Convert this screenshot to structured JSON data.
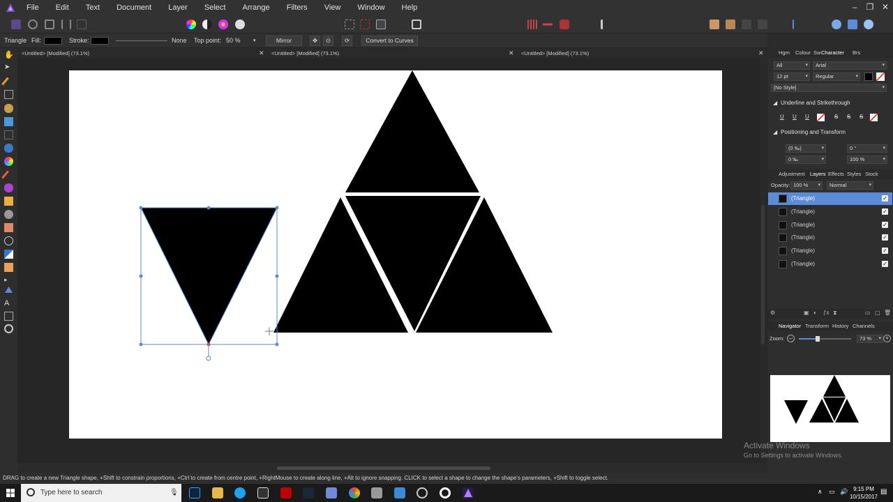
{
  "menubar": {
    "items": [
      "File",
      "Edit",
      "Text",
      "Document",
      "Layer",
      "Select",
      "Arrange",
      "Filters",
      "View",
      "Window",
      "Help"
    ]
  },
  "context": {
    "tool_name": "Triangle",
    "fill_label": "Fill:",
    "stroke_label": "Stroke:",
    "stroke_value": "None",
    "top_point_label": "Top point:",
    "top_point_value": "50 %",
    "mirror_label": "Mirror",
    "convert_label": "Convert to Curves"
  },
  "tabs": [
    {
      "label": "<Untitled> [Modified] (73.1%)"
    },
    {
      "label": "<Untitled> [Modified] (73.1%)"
    },
    {
      "label": "<Untitled> [Modified] (73.1%)"
    }
  ],
  "panel_top": {
    "tabs": [
      "Hgm",
      "Colour",
      "Sw",
      "Character",
      "Brs"
    ],
    "font_collection": "All",
    "font_family": "Arial",
    "font_size": "12 pt",
    "font_style": "Regular",
    "text_style": "[No Style]",
    "section_underline": "Underline and Strikethrough",
    "section_position": "Positioning and Transform",
    "tracking": "(0 ‰)",
    "baseline": "0 ‰",
    "skew": "0 °",
    "scale": "100 %"
  },
  "panel_layers": {
    "tabs": [
      "Adjustment",
      "Layers",
      "Effects",
      "Styles",
      "Stock"
    ],
    "opacity_label": "Opacity:",
    "opacity_value": "100 %",
    "blend_mode": "Normal",
    "layers": [
      {
        "name": "(Triangle)",
        "selected": true
      },
      {
        "name": "(Triangle)",
        "selected": false
      },
      {
        "name": "(Triangle)",
        "selected": false
      },
      {
        "name": "(Triangle)",
        "selected": false
      },
      {
        "name": "(Triangle)",
        "selected": false
      },
      {
        "name": "(Triangle)",
        "selected": false
      }
    ]
  },
  "panel_nav": {
    "tabs": [
      "Navigator",
      "Transform",
      "History",
      "Channels"
    ],
    "zoom_label": "Zoom:",
    "zoom_value": "73 %"
  },
  "status": {
    "hint": "DRAG to create a new Triangle shape, +Shift to constrain proportions, +Ctrl to create from centre point, +RightMouse to create along line, +Alt to ignore snapping. CLICK to select a shape to change the shape's parameters, +Shift to toggle select."
  },
  "watermark": {
    "line1": "Activate Windows",
    "line2": "Go to Settings to activate Windows."
  },
  "taskbar": {
    "search_placeholder": "Type here to search",
    "time": "9:15 PM",
    "date": "10/15/2017"
  },
  "colors": {
    "accent": "#5b8bd9",
    "selection": "#4a7fd0",
    "canvas_bg": "#ffffff",
    "shape_fill": "#000000"
  }
}
